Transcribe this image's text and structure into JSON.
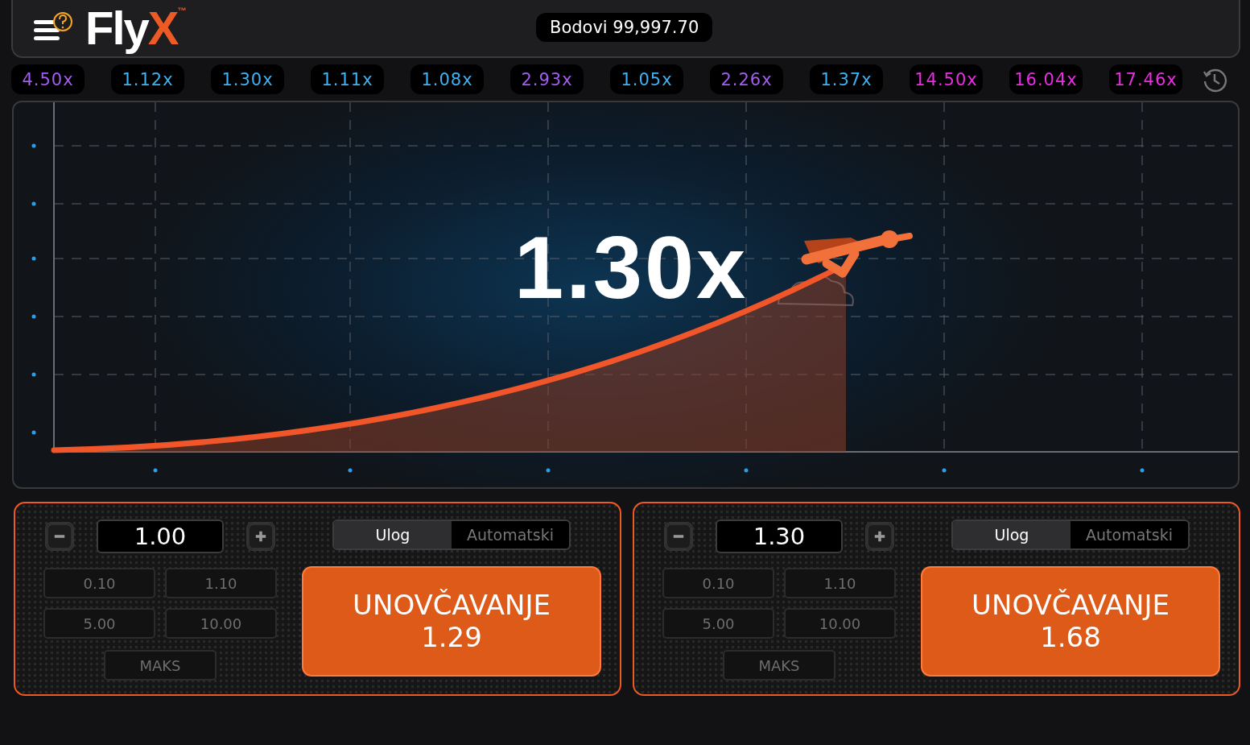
{
  "header": {
    "logo": {
      "text": "Fly",
      "accent": "X",
      "mark": "™"
    },
    "balance": "Bodovi 99,997.70"
  },
  "history": [
    {
      "value": "4.50x",
      "color": "#a35cf0"
    },
    {
      "value": "1.12x",
      "color": "#3fb1f2"
    },
    {
      "value": "1.30x",
      "color": "#3fb1f2"
    },
    {
      "value": "1.11x",
      "color": "#3fb1f2"
    },
    {
      "value": "1.08x",
      "color": "#3fb1f2"
    },
    {
      "value": "2.93x",
      "color": "#a35cf0"
    },
    {
      "value": "1.05x",
      "color": "#3fb1f2"
    },
    {
      "value": "2.26x",
      "color": "#a35cf0"
    },
    {
      "value": "1.37x",
      "color": "#3fb1f2"
    },
    {
      "value": "14.50x",
      "color": "#e72ee0"
    },
    {
      "value": "16.04x",
      "color": "#e72ee0"
    },
    {
      "value": "17.46x",
      "color": "#e72ee0"
    }
  ],
  "game": {
    "multiplier": "1.30x"
  },
  "panels": [
    {
      "amount": "1.00",
      "quick": [
        "0.10",
        "1.10",
        "5.00",
        "10.00"
      ],
      "max": "MAKS",
      "tabs": [
        {
          "label": "Ulog",
          "selected": true
        },
        {
          "label": "Automatski",
          "selected": false
        }
      ],
      "action": {
        "label": "UNOVČAVANJE",
        "amount": "1.29"
      }
    },
    {
      "amount": "1.30",
      "quick": [
        "0.10",
        "1.10",
        "5.00",
        "10.00"
      ],
      "max": "MAKS",
      "tabs": [
        {
          "label": "Ulog",
          "selected": true
        },
        {
          "label": "Automatski",
          "selected": false
        }
      ],
      "action": {
        "label": "UNOVČAVANJE",
        "amount": "1.68"
      }
    }
  ]
}
